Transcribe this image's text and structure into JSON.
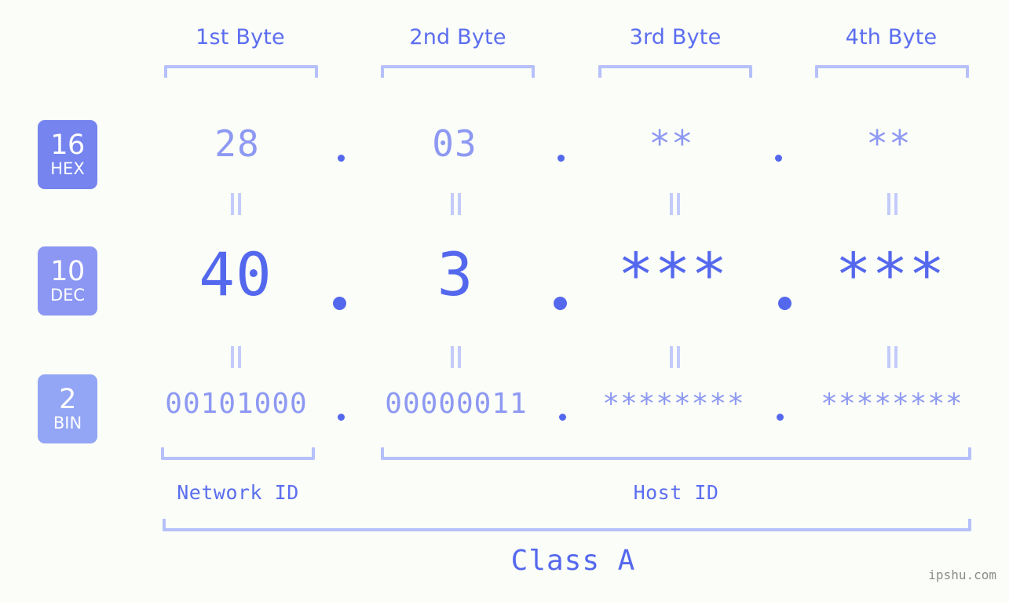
{
  "background_color": "#fbfdf8",
  "accent_colors": {
    "header_blue": "#5b6ef0",
    "bracket_blue": "#b6c0fa",
    "hex_value": "#8d99f2",
    "dec_value": "#5468ee",
    "bin_value": "#8d99f2",
    "equals_mark": "#c3cbfb",
    "badge_hex": "#7584ef",
    "badge_dec": "#8b97f3",
    "badge_bin": "#93a5f5",
    "watermark": "#8c8c8c"
  },
  "byte_headers": [
    {
      "label": "1st Byte"
    },
    {
      "label": "2nd Byte"
    },
    {
      "label": "3rd Byte"
    },
    {
      "label": "4th Byte"
    }
  ],
  "bases": [
    {
      "number": "16",
      "name": "HEX"
    },
    {
      "number": "10",
      "name": "DEC"
    },
    {
      "number": "2",
      "name": "BIN"
    }
  ],
  "rows": {
    "hex": {
      "bytes": [
        "28",
        "03",
        "**",
        "**"
      ]
    },
    "dec": {
      "bytes": [
        "40",
        "3",
        "***",
        "***"
      ]
    },
    "bin": {
      "bytes": [
        "00101000",
        "00000011",
        "********",
        "********"
      ]
    }
  },
  "separators": {
    "dot": ".",
    "equals": "="
  },
  "segments": [
    {
      "label": "Network ID"
    },
    {
      "label": "Host ID"
    }
  ],
  "class": {
    "label": "Class A"
  },
  "watermark": {
    "text": "ipshu.com"
  }
}
